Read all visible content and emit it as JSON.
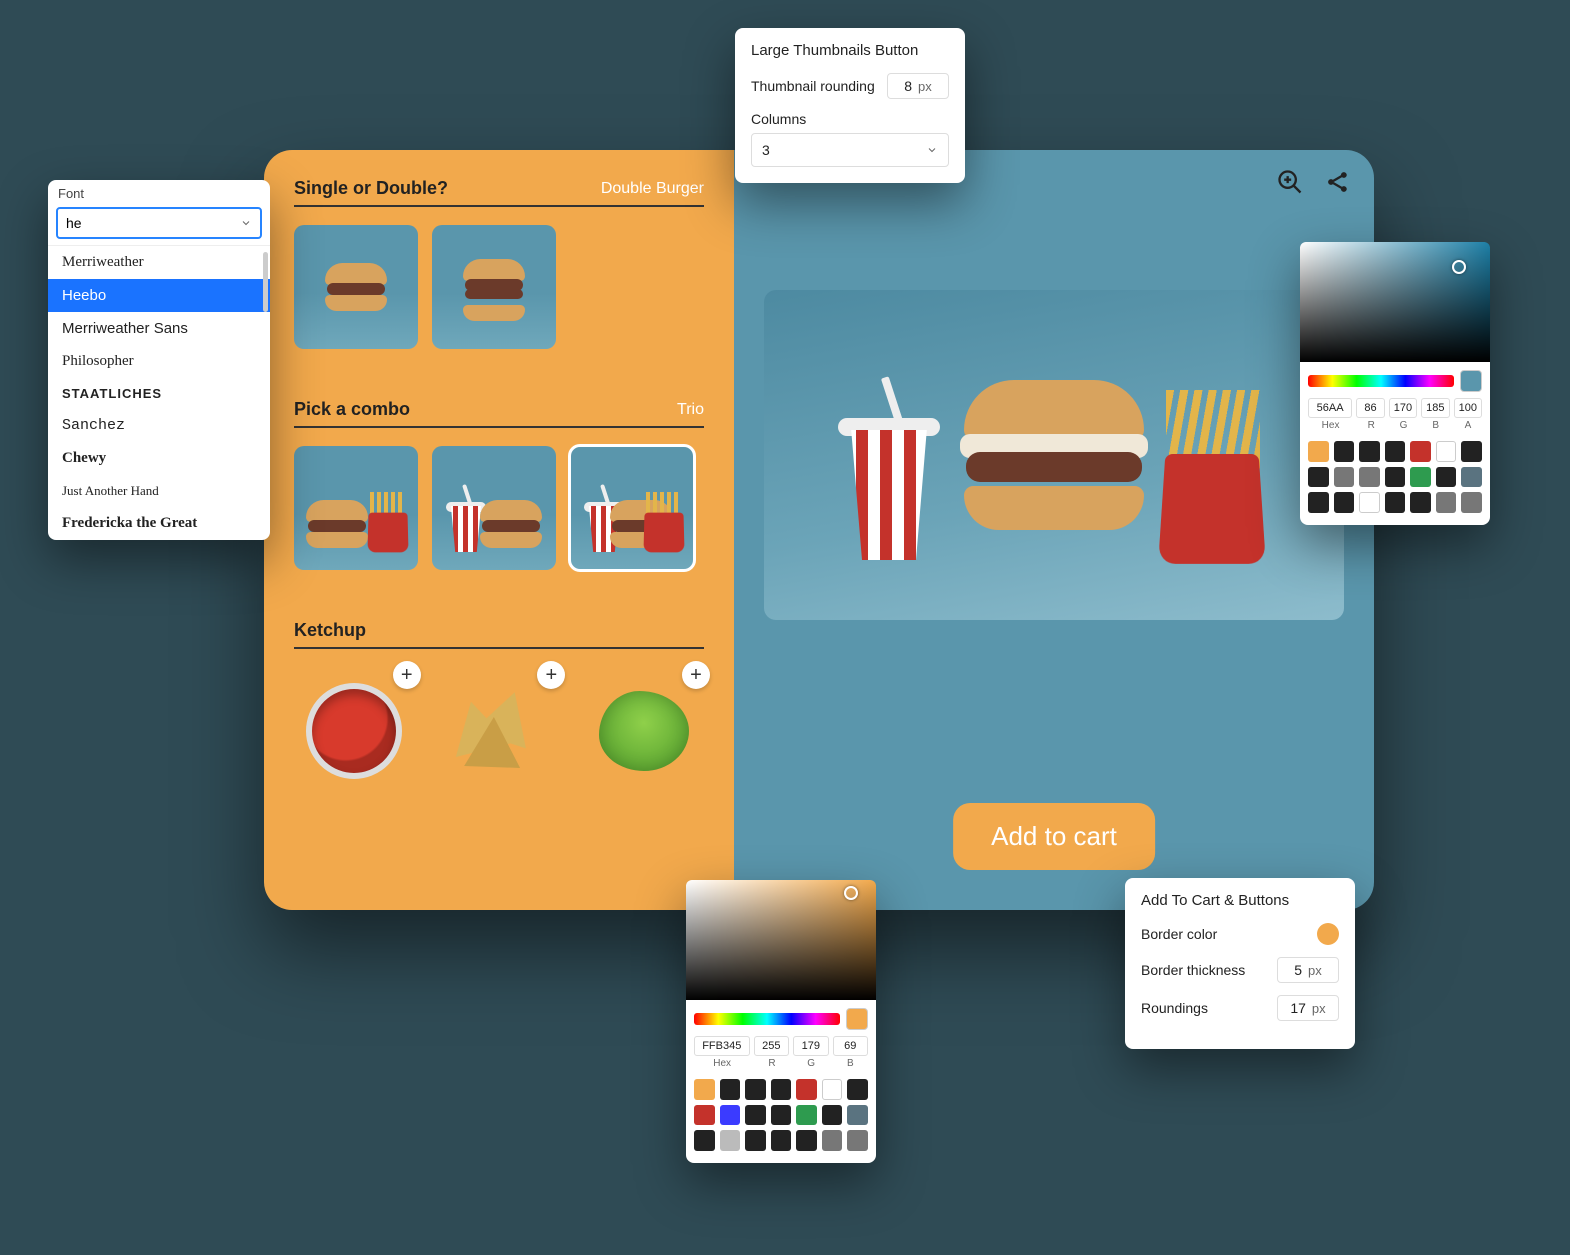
{
  "font_picker": {
    "label": "Font",
    "input_value": "he",
    "options": [
      {
        "label": "Merriweather",
        "cls": "ff-serif"
      },
      {
        "label": "Heebo",
        "cls": "ff-sans",
        "selected": true
      },
      {
        "label": "Merriweather Sans",
        "cls": "ff-sans"
      },
      {
        "label": "Philosopher",
        "cls": "ff-serif"
      },
      {
        "label": "STAATLICHES",
        "cls": "ff-cond"
      },
      {
        "label": "Sanchez",
        "cls": "ff-slab"
      },
      {
        "label": "Chewy",
        "cls": "ff-chewy"
      },
      {
        "label": "Just Another Hand",
        "cls": "ff-script"
      },
      {
        "label": "Fredericka the Great",
        "cls": "ff-display"
      }
    ]
  },
  "thumbnails_panel": {
    "title": "Large Thumbnails Button",
    "rounding_label": "Thumbnail rounding",
    "rounding_value": "8",
    "rounding_unit": "px",
    "columns_label": "Columns",
    "columns_value": "3"
  },
  "sections": {
    "s1": {
      "title": "Single or Double?",
      "value": "Double Burger"
    },
    "s2": {
      "title": "Pick a combo",
      "value": "Trio"
    },
    "s3": {
      "title": "Ketchup"
    }
  },
  "add_to_cart_label": "Add to cart",
  "buttons_panel": {
    "title": "Add To Cart & Buttons",
    "border_color_label": "Border color",
    "thickness_label": "Border thickness",
    "thickness_value": "5",
    "thickness_unit": "px",
    "roundings_label": "Roundings",
    "roundings_value": "17",
    "roundings_unit": "px"
  },
  "color_picker_1": {
    "hex": "56AA",
    "r": "86",
    "g": "170",
    "b": "185",
    "a": "100",
    "labels": {
      "hex": "Hex",
      "r": "R",
      "g": "G",
      "b": "B",
      "a": "A"
    },
    "swatches": [
      "#f2a94c",
      "#222",
      "#222",
      "#222",
      "#c4322b",
      "#fff",
      "#222",
      "#222",
      "#777",
      "#777",
      "#222",
      "#2e9b4f",
      "#222",
      "#5a7380",
      "#222",
      "#222",
      "#fff",
      "#222",
      "#222",
      "#777",
      "#777"
    ]
  },
  "color_picker_2": {
    "hex": "FFB345",
    "r": "255",
    "g": "179",
    "b": "69",
    "labels": {
      "hex": "Hex",
      "r": "R",
      "g": "G",
      "b": "B"
    },
    "swatches": [
      "#f2a94c",
      "#222",
      "#222",
      "#222",
      "#c4322b",
      "#fff",
      "#222",
      "#c4322b",
      "#3b3bff",
      "#222",
      "#222",
      "#2e9b4f",
      "#222",
      "#5a7380",
      "#222",
      "#bbb",
      "#222",
      "#222",
      "#222",
      "#777",
      "#777"
    ]
  }
}
